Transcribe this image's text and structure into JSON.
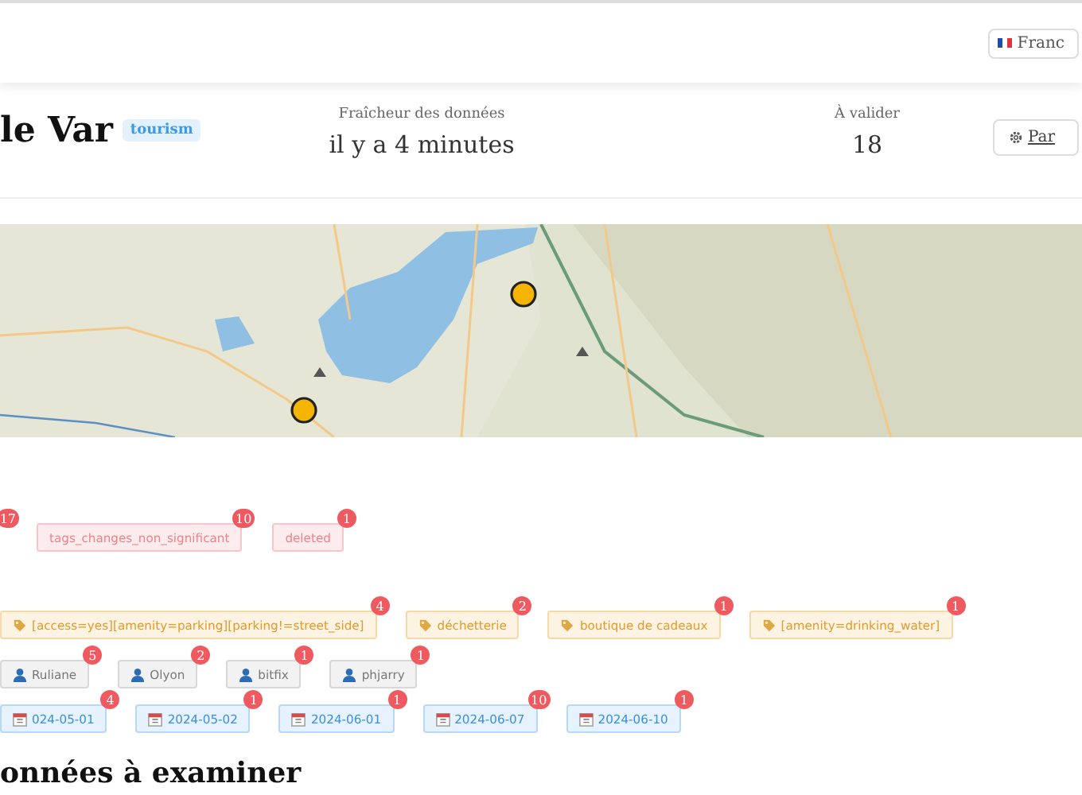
{
  "top_bar": {
    "language_button": {
      "label": "Franc"
    }
  },
  "header": {
    "title": "le Var",
    "theme_badge": "tourism",
    "stats": [
      {
        "label": "Fraîcheur des données",
        "value": "il y a 4 minutes"
      },
      {
        "label": "À valider",
        "value": "18"
      }
    ],
    "settings_button": {
      "label": "Par"
    }
  },
  "filter_groups": [
    {
      "kind": "status",
      "chips": [
        {
          "count": "17"
        },
        {
          "label": "tags_changes_non_significant",
          "count": "10"
        },
        {
          "label": "deleted",
          "count": "1"
        }
      ]
    },
    {
      "kind": "tag",
      "chips": [
        {
          "label": "[access=yes][amenity=parking][parking!=street_side]",
          "count": "4"
        },
        {
          "label": "déchetterie",
          "count": "2"
        },
        {
          "label": "boutique de cadeaux",
          "count": "1"
        },
        {
          "label": "[amenity=drinking_water]",
          "count": "1"
        }
      ]
    },
    {
      "kind": "user",
      "chips": [
        {
          "label": "Ruliane",
          "count": "5"
        },
        {
          "label": "Olyon",
          "count": "2"
        },
        {
          "label": "bitfix",
          "count": "1"
        },
        {
          "label": "phjarry",
          "count": "1"
        }
      ]
    },
    {
      "kind": "date",
      "chips": [
        {
          "label": "024-05-01",
          "count": "4"
        },
        {
          "label": "2024-05-02",
          "count": "1"
        },
        {
          "label": "2024-06-01",
          "count": "1"
        },
        {
          "label": "2024-06-07",
          "count": "10"
        },
        {
          "label": "2024-06-10",
          "count": "1"
        }
      ]
    }
  ],
  "section_heading": "onnées à examiner"
}
